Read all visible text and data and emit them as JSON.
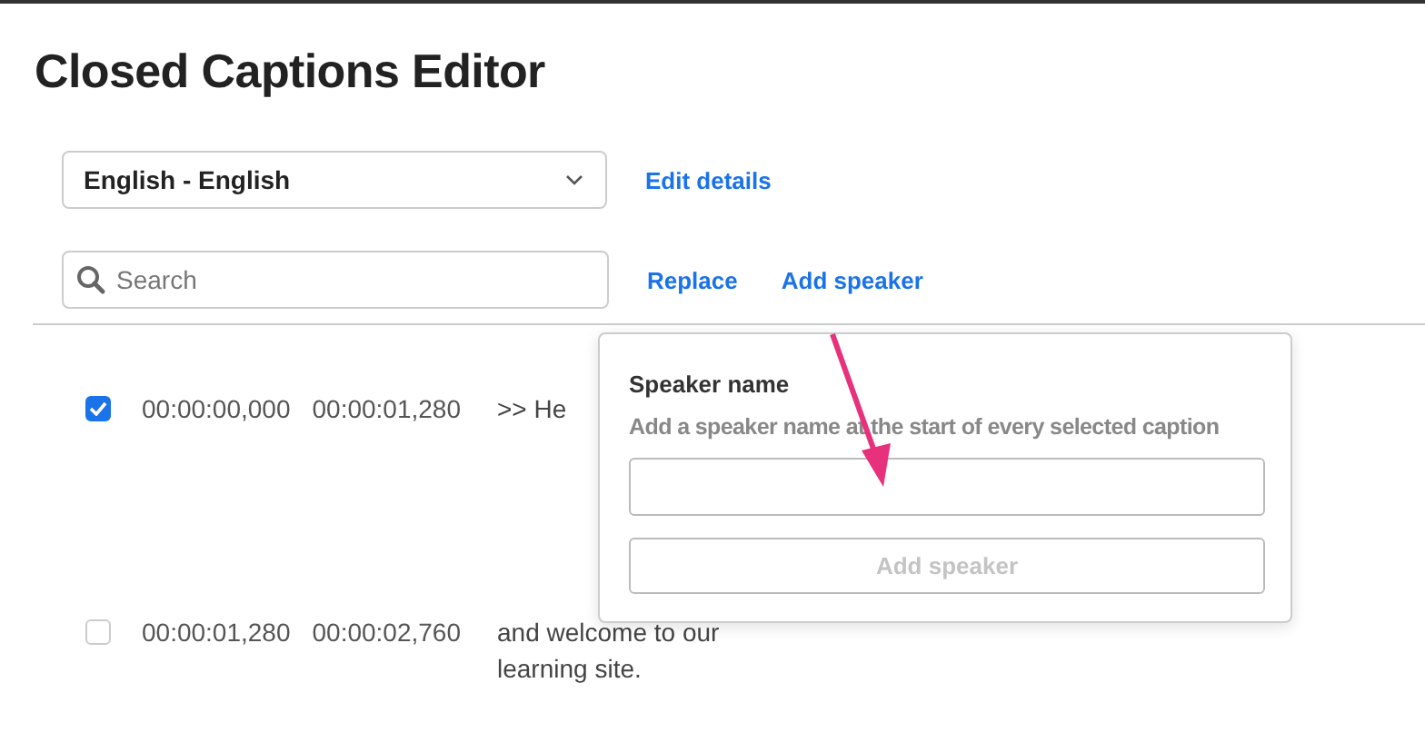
{
  "title": "Closed Captions Editor",
  "language": {
    "value": "English - English"
  },
  "edit_details": "Edit details",
  "search": {
    "placeholder": "Search"
  },
  "actions": [
    "Replace",
    "Add speaker"
  ],
  "captions": [
    {
      "selected": true,
      "start": "00:00:00,000",
      "end": "00:00:01,280",
      "text": ">> He"
    },
    {
      "selected": false,
      "start": "00:00:01,280",
      "end": "00:00:02,760",
      "text": "and welcome to our learning site."
    }
  ],
  "popup": {
    "label": "Speaker name",
    "hint": "Add a speaker name at the start of every selected caption",
    "button": "Add speaker",
    "button_disabled": true
  }
}
